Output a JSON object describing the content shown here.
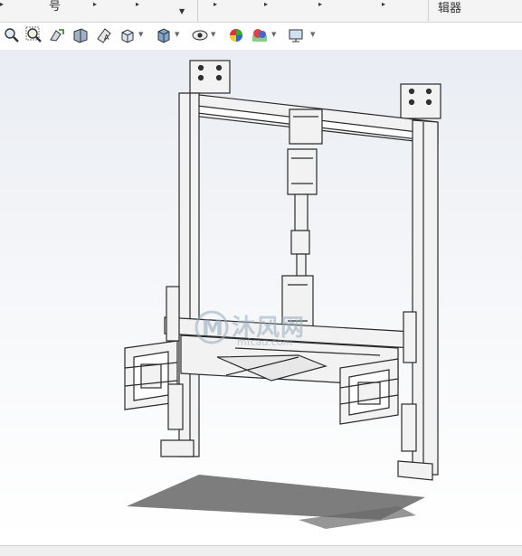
{
  "ribbon": {
    "label_left": "号",
    "label_right": "辑器"
  },
  "toolbar": {
    "buttons": [
      "zoom-to-fit",
      "zoom-to-area",
      "previous-view",
      "section-view",
      "dynamic-annotation-views",
      "view-orientation",
      "display-style",
      "hide-show-items",
      "edit-appearance",
      "apply-scene",
      "view-settings"
    ]
  },
  "watermark": {
    "title": "沐风网",
    "url": "mfcad.com"
  },
  "colors": {
    "ribbon_bg": "#f4f4f4",
    "viewport_top": "#e9edf3",
    "model_line": "#2b2b2b",
    "model_fill": "#f2f2f2",
    "shadow": "#5a5a5a"
  }
}
